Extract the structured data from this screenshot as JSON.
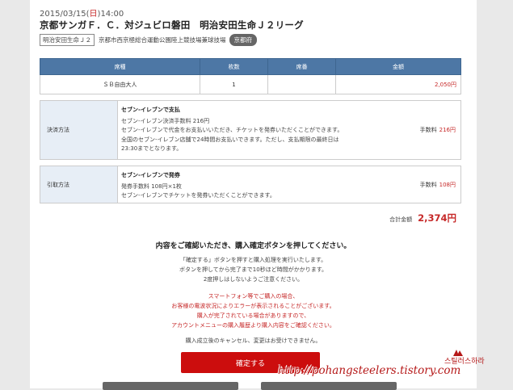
{
  "match": {
    "date": "2015/03/15(",
    "dow": "日",
    "time": ")14:00",
    "title": "京都サンガＦ．Ｃ．対ジュビロ磐田　明治安田生命Ｊ２リーグ",
    "league_tag": "明治安田生命Ｊ２",
    "venue": "京都市西京極総合運動公園陸上競技場兼球技場",
    "prefecture": "京都府"
  },
  "ticket_table": {
    "headers": [
      "席種",
      "枚数",
      "席番",
      "金額"
    ],
    "rows": [
      {
        "seat_type": "ＳＢ自由大人",
        "count": "1",
        "seat_no": "",
        "price": "2,050円"
      }
    ]
  },
  "payment": {
    "label": "決済方法",
    "heading": "セブン-イレブンで支払",
    "lines": [
      "セブン-イレブン決済手数料 216円",
      "セブン-イレブンで代金をお支払いいただき、チケットを発券いただくことができます。",
      "全国のセブン-イレブン店舗で24時間お支払いできます。ただし、支払期限の最終日は",
      "23:30までとなります。"
    ],
    "fee_label": "手数料",
    "fee_value": "216円"
  },
  "pickup": {
    "label": "引取方法",
    "heading": "セブン-イレブンで発券",
    "lines": [
      "発券手数料 108円×1枚",
      "セブン-イレブンでチケットを発券いただくことができます。"
    ],
    "fee_label": "手数料",
    "fee_value": "108円"
  },
  "total": {
    "label": "合計金額",
    "value": "2,374円"
  },
  "confirm": {
    "heading": "内容をご確認いただき、購入確定ボタンを押してください。",
    "notes": [
      "「確定する」ボタンを押すと購入処理を実行いたします。",
      "ボタンを押してから完了まで10秒ほど時間がかかります。",
      "2度押しはしないようご注意ください。"
    ],
    "warnings": [
      "スマートフォン等でご購入の場合、",
      "お客様の電波状況によりエラーが表示されることがございます。",
      "購入が完了されている場合がありますので、",
      "アカウントメニューの購入履歴より購入内容をご確認ください。"
    ],
    "cancel_note": "購入成立後のキャンセル、変更はお受けできません。",
    "button_label": "確定する"
  },
  "watermark": {
    "url": "http://pohangsteelers.tistory.com",
    "korean": "스틸러스하라"
  },
  "colors": {
    "table_header": "#4d77a5",
    "accent_red": "#cc0d0d",
    "label_bg": "#e7eef6"
  }
}
